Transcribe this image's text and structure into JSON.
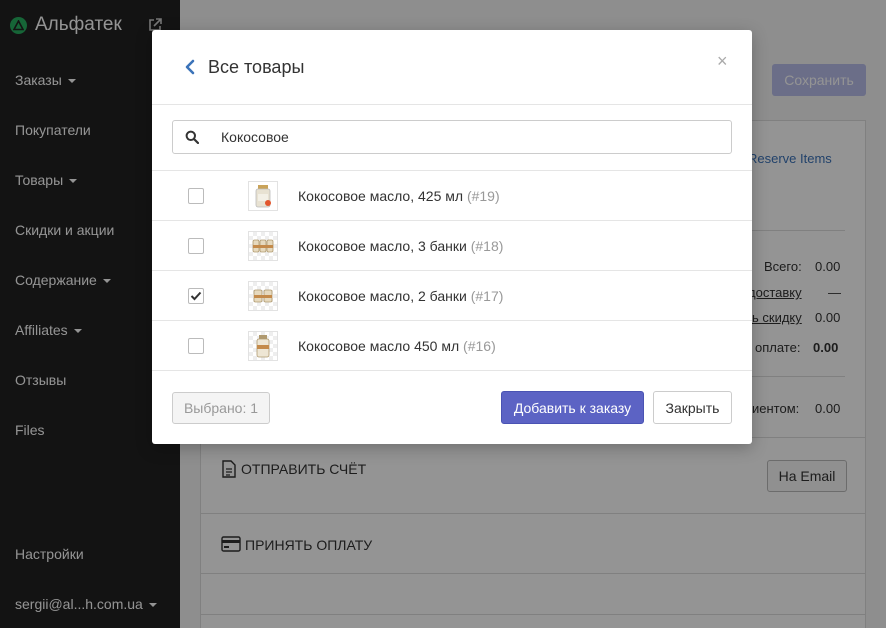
{
  "sidebar": {
    "brand": "Альфатек",
    "items": [
      {
        "label": "Заказы",
        "dropdown": true
      },
      {
        "label": "Покупатели",
        "dropdown": false
      },
      {
        "label": "Товары",
        "dropdown": true
      },
      {
        "label": "Скидки и акции",
        "dropdown": false
      },
      {
        "label": "Содержание",
        "dropdown": true
      },
      {
        "label": "Affiliates",
        "dropdown": true
      },
      {
        "label": "Отзывы",
        "dropdown": false
      },
      {
        "label": "Files",
        "dropdown": false
      }
    ],
    "settings": "Настройки",
    "user": "sergii@al...h.com.ua"
  },
  "background": {
    "save_label": "Сохранить",
    "reserve_items": "Reserve Items",
    "total_label": "Всего:",
    "total_value": "0.00",
    "shipping_link": "доставку",
    "shipping_value": "—",
    "discount_link": "ь скидку",
    "discount_value": "0.00",
    "to_pay_label": "оплате:",
    "to_pay_value": "0.00",
    "customer_label": "иентом:",
    "customer_value": "0.00",
    "send_invoice": "ОТПРАВИТЬ СЧЁТ",
    "email_button": "На Email",
    "accept_payment": "ПРИНЯТЬ ОПЛАТУ"
  },
  "modal": {
    "title": "Все товары",
    "close_glyph": "×",
    "search": {
      "value": "Кокосовое",
      "placeholder": ""
    },
    "products": [
      {
        "name": "Кокосовое масло, 425 мл",
        "id": "(#19)",
        "checked": false,
        "thumb": "jar"
      },
      {
        "name": "Кокосовое масло, 3 банки",
        "id": "(#18)",
        "checked": false,
        "thumb": "jars"
      },
      {
        "name": "Кокосовое масло, 2 банки",
        "id": "(#17)",
        "checked": true,
        "thumb": "jars"
      },
      {
        "name": "Кокосовое масло 450 мл",
        "id": "(#16)",
        "checked": false,
        "thumb": "jar-clear"
      }
    ],
    "footer": {
      "selected_label": "Выбрано: 1",
      "add_label": "Добавить к заказу",
      "close_label": "Закрыть"
    }
  },
  "colors": {
    "sidebar_bg": "#222222",
    "primary": "#5c63c4",
    "link": "#3b73b9"
  }
}
